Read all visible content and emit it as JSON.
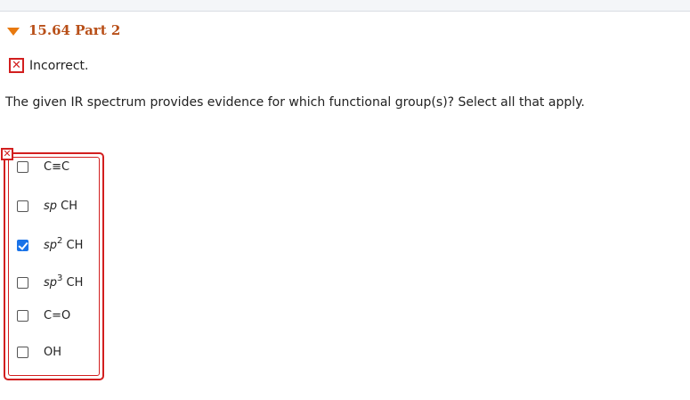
{
  "header": {
    "part_title": "15.64 Part 2"
  },
  "status": {
    "text": "Incorrect."
  },
  "question": {
    "text": "The given IR spectrum provides evidence for which functional group(s)? Select all that apply."
  },
  "options": [
    {
      "label": "C≡C",
      "checked": false
    },
    {
      "prefix": "sp",
      "suffix": " CH",
      "checked": false
    },
    {
      "prefix": "sp",
      "sup": "2",
      "suffix": " CH",
      "checked": true
    },
    {
      "prefix": "sp",
      "sup": "3",
      "suffix": " CH",
      "checked": false
    },
    {
      "label": "C=O",
      "checked": false
    },
    {
      "label": "OH",
      "checked": false
    }
  ],
  "colors": {
    "accent_orange": "#e8790f",
    "title_color": "#b84f18",
    "incorrect_red": "#d21f1f",
    "checked_blue": "#1a73e8"
  },
  "icons": {
    "collapse": "triangle-down-icon",
    "incorrect": "x-mark-icon"
  }
}
